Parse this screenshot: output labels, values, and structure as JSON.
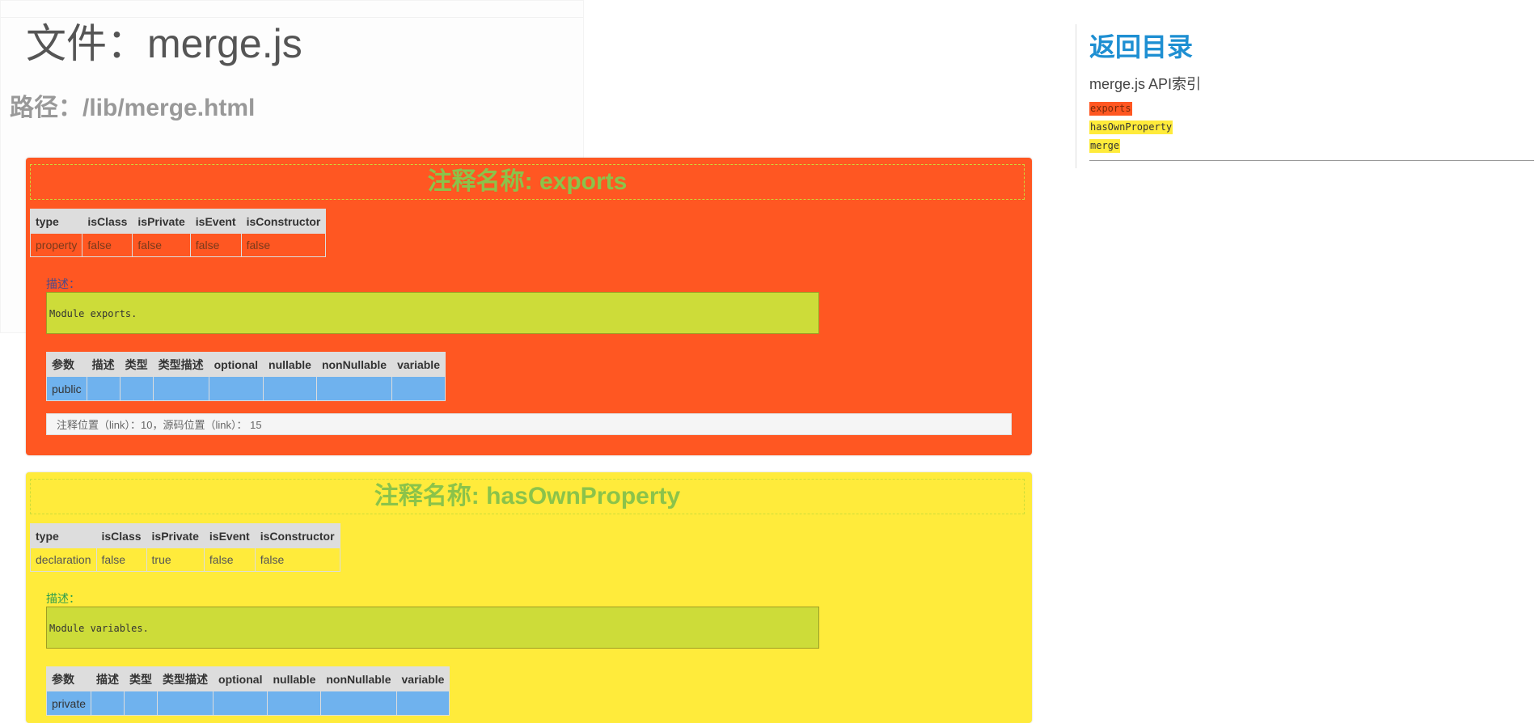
{
  "page": {
    "file_title": "文件：merge.js",
    "path_title": "路径：/lib/merge.html"
  },
  "sidebar": {
    "back_label": "返回目录",
    "subtitle": "merge.js API索引",
    "links": [
      "exports",
      "hasOwnProperty",
      "merge"
    ]
  },
  "blocks": [
    {
      "name_label": "注释名称: exports",
      "attr_headers": [
        "type",
        "isClass",
        "isPrivate",
        "isEvent",
        "isConstructor"
      ],
      "attr_values": [
        "property",
        "false",
        "false",
        "false",
        "false"
      ],
      "desc_label": "描述：",
      "desc_text": "Module exports.",
      "param_headers": [
        "参数",
        "描述",
        "类型",
        "类型描述",
        "optional",
        "nullable",
        "nonNullable",
        "variable"
      ],
      "param_row": [
        "public",
        "",
        "",
        "",
        "",
        "",
        "",
        ""
      ],
      "location_text": "注释位置（link）：10，源码位置（link）： 15",
      "color": "#ff5722"
    },
    {
      "name_label": "注释名称: hasOwnProperty",
      "attr_headers": [
        "type",
        "isClass",
        "isPrivate",
        "isEvent",
        "isConstructor"
      ],
      "attr_values": [
        "declaration",
        "false",
        "true",
        "false",
        "false"
      ],
      "desc_label": "描述：",
      "desc_text": "Module variables.",
      "param_headers": [
        "参数",
        "描述",
        "类型",
        "类型描述",
        "optional",
        "nullable",
        "nonNullable",
        "variable"
      ],
      "param_row": [
        "private",
        "",
        "",
        "",
        "",
        "",
        "",
        ""
      ],
      "color": "#ffeb3b"
    }
  ]
}
